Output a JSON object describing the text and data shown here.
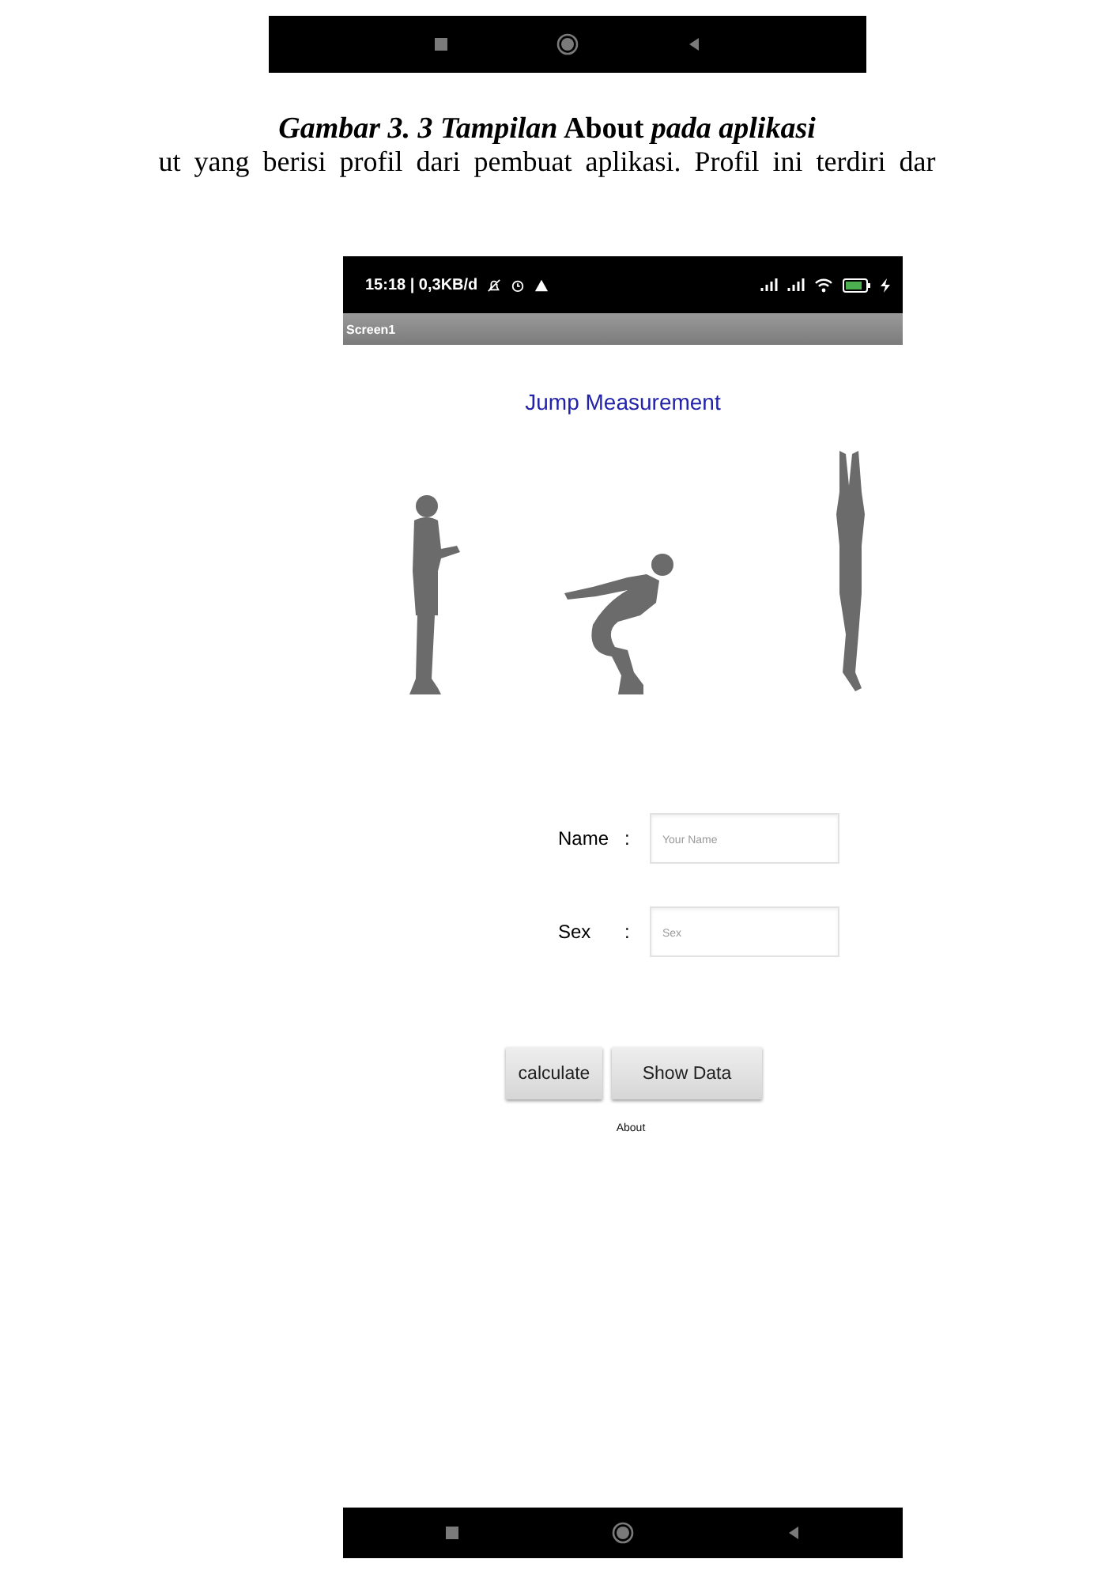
{
  "caption": "*Gambar 3. 3 Tampilan* About *pada aplikasi*",
  "body_text": "ut yang berisi profil dari pembuat aplikasi. Profil ini terdiri dar",
  "phone": {
    "status_bar": {
      "text": "15:18 | 0,3KB/d"
    },
    "title_bar": {
      "title": "Screen1"
    },
    "app_title": "Jump Measurement",
    "form": [
      {
        "label": "Name",
        "separator": ":",
        "placeholder": "Your Name"
      },
      {
        "label": "Sex",
        "separator": ":",
        "placeholder": "Sex"
      }
    ],
    "buttons": [
      "calculate",
      "Show Data"
    ],
    "link": "About"
  }
}
